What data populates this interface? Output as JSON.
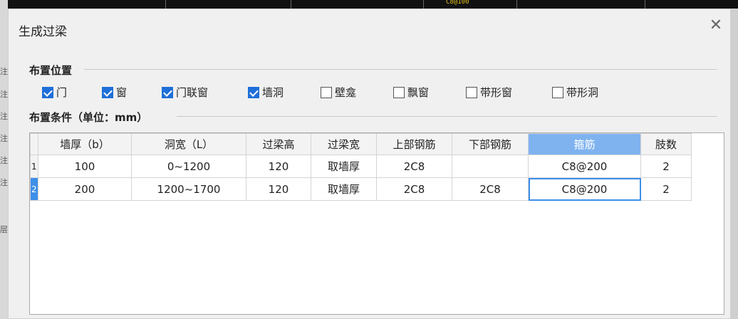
{
  "dialog": {
    "title": "生成过梁",
    "close_glyph": "✕"
  },
  "placement": {
    "label": "布置位置",
    "options": [
      {
        "label": "门",
        "checked": true
      },
      {
        "label": "窗",
        "checked": true
      },
      {
        "label": "门联窗",
        "checked": true
      },
      {
        "label": "墙洞",
        "checked": true
      },
      {
        "label": "壁龛",
        "checked": false
      },
      {
        "label": "飘窗",
        "checked": false
      },
      {
        "label": "带形窗",
        "checked": false
      },
      {
        "label": "带形洞",
        "checked": false
      }
    ]
  },
  "conditions": {
    "label": "布置条件（单位：mm）",
    "columns": [
      "墙厚（b）",
      "洞宽（L）",
      "过梁高",
      "过梁宽",
      "上部钢筋",
      "下部钢筋",
      "箍筋",
      "肢数"
    ],
    "active_column": 6,
    "rows": [
      {
        "num": "1",
        "cells": [
          "100",
          "0~1200",
          "120",
          "取墙厚",
          "2C8",
          "",
          "C8@200",
          "2"
        ],
        "selected": false
      },
      {
        "num": "2",
        "cells": [
          "200",
          "1200~1700",
          "120",
          "取墙厚",
          "2C8",
          "2C8",
          "C8@200",
          "2"
        ],
        "selected": true
      }
    ]
  },
  "background": {
    "top_tag": "C8@100",
    "left_marks": [
      "注)",
      "注)",
      "注)",
      "注)",
      "注)",
      "注)",
      "层"
    ]
  }
}
